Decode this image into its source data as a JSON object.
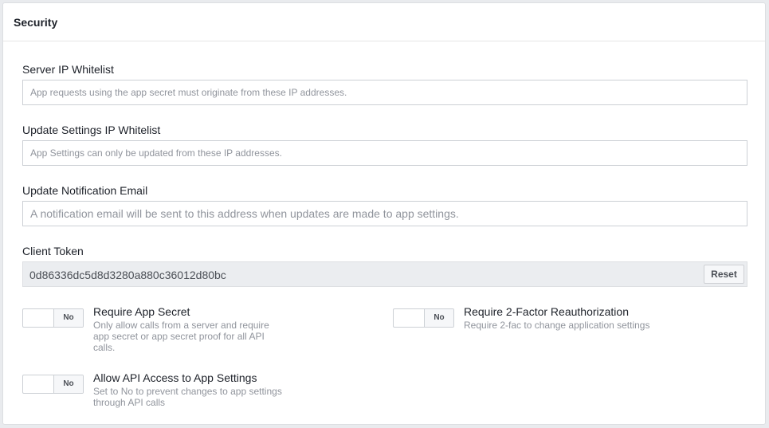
{
  "panel": {
    "title": "Security"
  },
  "fields": {
    "server_ip": {
      "label": "Server IP Whitelist",
      "placeholder": "App requests using the app secret must originate from these IP addresses."
    },
    "settings_ip": {
      "label": "Update Settings IP Whitelist",
      "placeholder": "App Settings can only be updated from these IP addresses."
    },
    "notify_email": {
      "label": "Update Notification Email",
      "placeholder": "A notification email will be sent to this address when updates are made to app settings."
    },
    "client_token": {
      "label": "Client Token",
      "value": "0d86336dc5d8d3280a880c36012d80bc",
      "reset_label": "Reset"
    }
  },
  "options": {
    "require_secret": {
      "toggle": "No",
      "title": "Require App Secret",
      "desc": [
        "Only allow calls from a server and require",
        "app secret or app secret proof for all API",
        "calls."
      ]
    },
    "two_factor": {
      "toggle": "No",
      "title": "Require 2-Factor Reauthorization",
      "desc": [
        "Require 2-fac to change application settings"
      ]
    },
    "api_access": {
      "toggle": "No",
      "title": "Allow API Access to App Settings",
      "desc": [
        "Set to No to prevent changes to app settings",
        "through API calls"
      ]
    }
  }
}
